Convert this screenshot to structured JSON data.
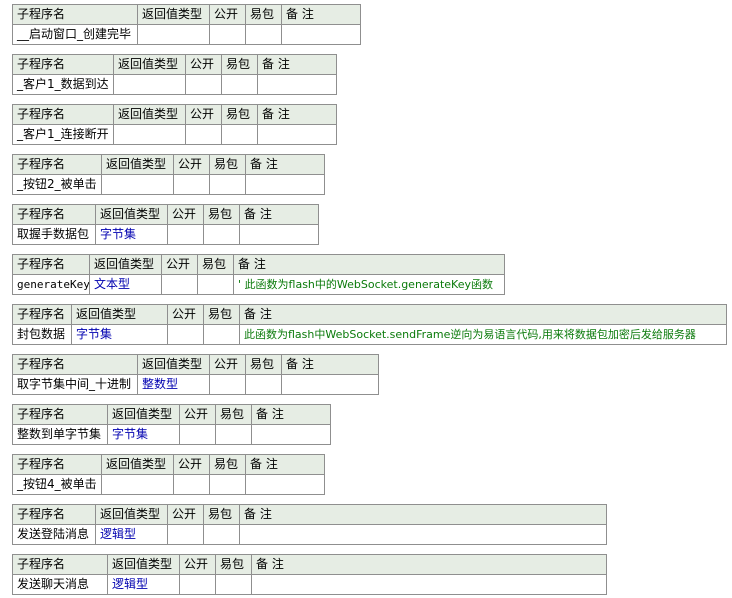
{
  "headers": {
    "name": "子程序名",
    "return_type": "返回值类型",
    "public": "公开",
    "easy_pack": "易包",
    "note": "备 注"
  },
  "subroutines": [
    {
      "name": "__启动窗口_创建完毕",
      "return_type": "",
      "public": "",
      "easy_pack": "",
      "note": ""
    },
    {
      "name": "_客户1_数据到达",
      "return_type": "",
      "public": "",
      "easy_pack": "",
      "note": ""
    },
    {
      "name": "_客户1_连接断开",
      "return_type": "",
      "public": "",
      "easy_pack": "",
      "note": ""
    },
    {
      "name": "_按钮2_被单击",
      "return_type": "",
      "public": "",
      "easy_pack": "",
      "note": ""
    },
    {
      "name": "取握手数据包",
      "return_type": "字节集",
      "public": "",
      "easy_pack": "",
      "note": ""
    },
    {
      "name": "generateKey",
      "return_type": "文本型",
      "public": "",
      "easy_pack": "",
      "note": "' 此函数为flash中的WebSocket.generateKey函数"
    },
    {
      "name": "封包数据",
      "return_type": "字节集",
      "public": "",
      "easy_pack": "",
      "note": "此函数为flash中WebSocket.sendFrame逆向为易语言代码,用来将数据包加密后发给服务器"
    },
    {
      "name": "取字节集中间_十进制",
      "return_type": "整数型",
      "public": "",
      "easy_pack": "",
      "note": ""
    },
    {
      "name": "整数到单字节集",
      "return_type": "字节集",
      "public": "",
      "easy_pack": "",
      "note": ""
    },
    {
      "name": "_按钮4_被单击",
      "return_type": "",
      "public": "",
      "easy_pack": "",
      "note": ""
    },
    {
      "name": "发送登陆消息",
      "return_type": "逻辑型",
      "public": "",
      "easy_pack": "",
      "note": ""
    },
    {
      "name": "发送聊天消息",
      "return_type": "逻辑型",
      "public": "",
      "easy_pack": "",
      "note": ""
    }
  ]
}
